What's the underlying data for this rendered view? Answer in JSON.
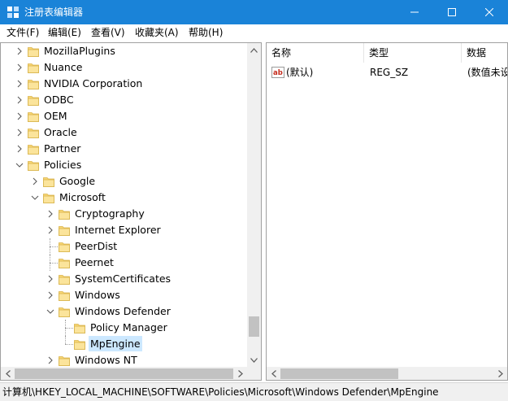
{
  "window": {
    "title": "注册表编辑器",
    "titlebar_color": "#1a83d8",
    "controls": [
      "minimize-icon",
      "maximize-icon",
      "close-icon"
    ]
  },
  "menu": {
    "items": [
      "文件(F)",
      "编辑(E)",
      "查看(V)",
      "收藏夹(A)",
      "帮助(H)"
    ]
  },
  "tree": {
    "items": [
      {
        "label": "MozillaPlugins",
        "level": 0,
        "expander": "collapsed"
      },
      {
        "label": "Nuance",
        "level": 0,
        "expander": "collapsed"
      },
      {
        "label": "NVIDIA Corporation",
        "level": 0,
        "expander": "collapsed"
      },
      {
        "label": "ODBC",
        "level": 0,
        "expander": "collapsed"
      },
      {
        "label": "OEM",
        "level": 0,
        "expander": "collapsed"
      },
      {
        "label": "Oracle",
        "level": 0,
        "expander": "collapsed"
      },
      {
        "label": "Partner",
        "level": 0,
        "expander": "collapsed"
      },
      {
        "label": "Policies",
        "level": 0,
        "expander": "expanded"
      },
      {
        "label": "Google",
        "level": 1,
        "expander": "collapsed"
      },
      {
        "label": "Microsoft",
        "level": 1,
        "expander": "expanded"
      },
      {
        "label": "Cryptography",
        "level": 2,
        "expander": "collapsed"
      },
      {
        "label": "Internet Explorer",
        "level": 2,
        "expander": "collapsed"
      },
      {
        "label": "PeerDist",
        "level": 2,
        "expander": "none"
      },
      {
        "label": "Peernet",
        "level": 2,
        "expander": "none"
      },
      {
        "label": "SystemCertificates",
        "level": 2,
        "expander": "collapsed"
      },
      {
        "label": "Windows",
        "level": 2,
        "expander": "collapsed"
      },
      {
        "label": "Windows Defender",
        "level": 2,
        "expander": "expanded"
      },
      {
        "label": "Policy Manager",
        "level": 3,
        "expander": "none"
      },
      {
        "label": "MpEngine",
        "level": 3,
        "expander": "none",
        "selected": true
      },
      {
        "label": "Windows NT",
        "level": 2,
        "expander": "collapsed"
      }
    ],
    "selected_color": "#cce8ff",
    "folder_color": "#f8d775"
  },
  "values": {
    "columns": [
      "名称",
      "类型",
      "数据"
    ],
    "rows": [
      {
        "icon": "string-value-icon",
        "name": "(默认)",
        "type": "REG_SZ",
        "data": "(数值未设置)"
      }
    ]
  },
  "status": {
    "path": "计算机\\HKEY_LOCAL_MACHINE\\SOFTWARE\\Policies\\Microsoft\\Windows Defender\\MpEngine"
  }
}
